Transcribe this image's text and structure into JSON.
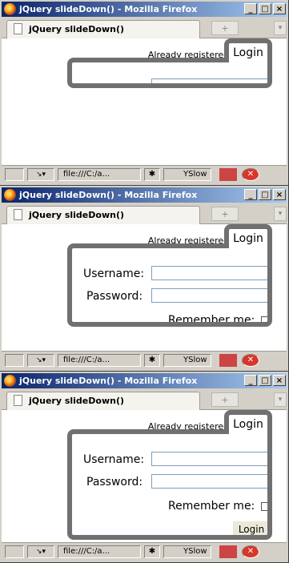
{
  "window": {
    "title": "jQuery slideDown() - Mozilla Firefox",
    "controls": {
      "minimize": "_",
      "maximize": "□",
      "close": "×"
    }
  },
  "tab": {
    "title": "jQuery slideDown()",
    "new_tab": "+",
    "scroll": "▾"
  },
  "status": {
    "url": "file:///C:/a...",
    "yslow": "YSlow"
  },
  "page": {
    "already_registered": "Already registered?",
    "login_tab": "Login",
    "username_label": "Username:",
    "password_label": "Password:",
    "remember_label": "Remember me:",
    "login_button": "Login"
  },
  "frames_note": "three frames of the same window showing the login panel sliding down",
  "colors": {
    "panel_border": "#707070",
    "titlebar": "#0a246a"
  },
  "icons": [
    "firefox-icon",
    "page-icon",
    "window-minimize-icon",
    "window-maximize-icon",
    "window-close-icon",
    "status-icon",
    "cursor-icon",
    "puzzle-icon",
    "yslow-icon",
    "mail-icon",
    "stop-icon"
  ]
}
